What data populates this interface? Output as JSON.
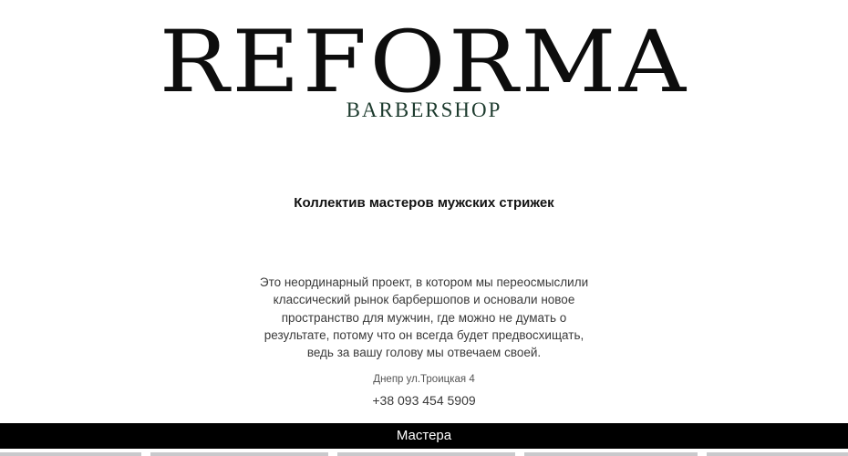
{
  "brand": {
    "name": "REFORMA",
    "subtitle": "BARBERSHOP"
  },
  "hero": {
    "tagline": "Коллектив мастеров мужских стрижек",
    "description_lines": [
      "Это неординарный проект, в котором мы переосмыслили",
      "классический рынок барбершопов и основали новое",
      "пространство для мужчин, где можно не думать о",
      "результате, потому что он всегда будет предвосхищать,",
      "ведь за вашу голову мы отвечаем своей."
    ]
  },
  "contact": {
    "address": "Днепр ул.Троицкая 4",
    "phone": "+38 093 454 5909"
  },
  "masters_section": {
    "label": "Мастера"
  },
  "colors": {
    "subtitle": "#1d3b2e",
    "bar_background": "#000000",
    "bar_text": "#ffffff"
  }
}
